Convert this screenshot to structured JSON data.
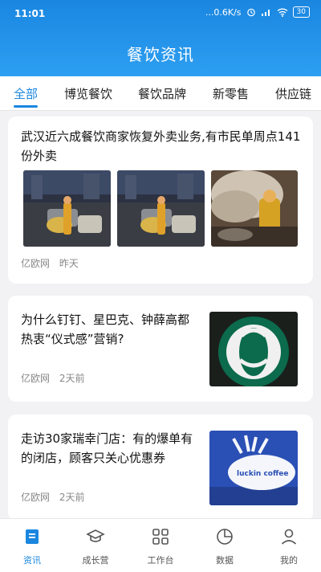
{
  "status_bar": {
    "time": "11:01",
    "network": "...0.6K/s",
    "battery": "30"
  },
  "header": {
    "title": "餐饮资讯"
  },
  "tabs": [
    "全部",
    "博览餐饮",
    "餐饮品牌",
    "新零售",
    "供应链"
  ],
  "active_tab": "全部",
  "articles": [
    {
      "title": "武汉近六成餐饮商家恢复外卖业务,有市民单周点141份外卖",
      "source": "亿欧网",
      "time": "昨天"
    },
    {
      "title": "为什么钉钉、星巴克、钟薛高都热衷“仪式感”营销?",
      "source": "亿欧网",
      "time": "2天前"
    },
    {
      "title": "走访30家瑞幸门店：有的爆单有的闭店，顾客只关心优惠券",
      "source": "亿欧网",
      "time": "2天前",
      "image_text": "luckin coffee"
    }
  ],
  "bottom_nav": [
    {
      "label": "资讯",
      "icon": "news-icon"
    },
    {
      "label": "成长营",
      "icon": "graduation-cap-icon"
    },
    {
      "label": "工作台",
      "icon": "grid-icon"
    },
    {
      "label": "数据",
      "icon": "pie-chart-icon"
    },
    {
      "label": "我的",
      "icon": "user-icon"
    }
  ],
  "colors": {
    "accent": "#1a86e0",
    "header": "#2d9ff2",
    "background": "#f2f2f4"
  }
}
